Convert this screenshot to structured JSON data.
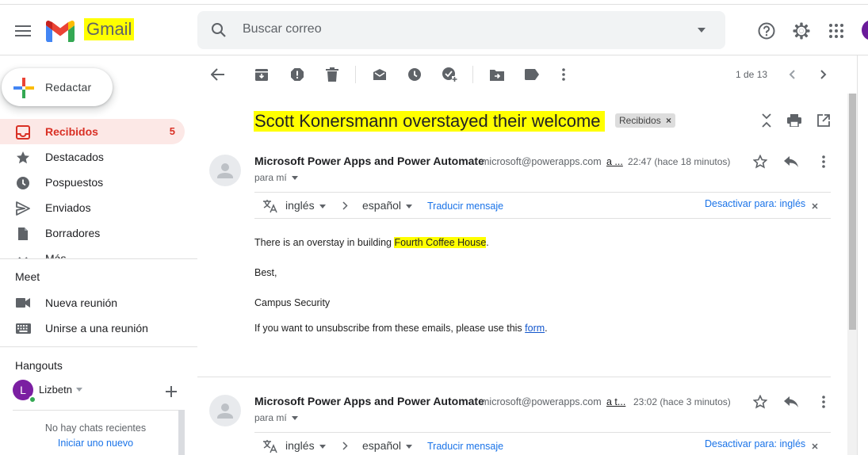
{
  "app": {
    "logo_text": "Gmail"
  },
  "search": {
    "placeholder": "Buscar correo"
  },
  "compose": {
    "label": "Redactar"
  },
  "sidebar": {
    "items": [
      {
        "label": "Recibidos",
        "count": "5",
        "icon": "inbox-icon"
      },
      {
        "label": "Destacados",
        "icon": "star-icon"
      },
      {
        "label": "Pospuestos",
        "icon": "clock-icon"
      },
      {
        "label": "Enviados",
        "icon": "send-icon"
      },
      {
        "label": "Borradores",
        "icon": "draft-icon"
      },
      {
        "label": "Más",
        "icon": "chevron-down-icon"
      }
    ]
  },
  "meet": {
    "title": "Meet",
    "new_meeting": "Nueva reunión",
    "join_meeting": "Unirse a una reunión"
  },
  "hangouts": {
    "title": "Hangouts",
    "user_initial": "L",
    "user_name": "Lizbetn",
    "no_chats": "No hay chats recientes",
    "start_new": "Iniciar uno nuevo"
  },
  "toolbar": {
    "pager": "1 de 13"
  },
  "thread": {
    "subject": "Scott Konersmann overstayed their welcome",
    "label": "Recibidos",
    "label_remove": "×"
  },
  "messages": [
    {
      "sender": "Microsoft Power Apps and Power Automate",
      "email": "microsoft@powerapps.com",
      "email_trunc": "a ...",
      "time": "22:47 (hace 18 minutos)",
      "to": "para mí",
      "from_lang": "inglés",
      "to_lang": "español",
      "translate": "Traducir mensaje",
      "disable": "Desactivar para: inglés",
      "body": {
        "line1_pre": "There is an overstay in building ",
        "line1_hl": "Fourth Coffee House",
        "line1_post": ".",
        "line2": "Best,",
        "line3": "Campus Security",
        "line4_pre": "If you want to unsubscribe from these emails, please use this ",
        "line4_link": "form",
        "line4_post": "."
      }
    },
    {
      "sender": "Microsoft Power Apps and Power Automate",
      "email": "microsoft@powerapps.com",
      "email_trunc": "a t...",
      "time": "23:02 (hace 3 minutos)",
      "to": "para mí",
      "from_lang": "inglés",
      "to_lang": "español",
      "translate": "Traducir mensaje",
      "disable": "Desactivar para: inglés"
    }
  ],
  "colors": {
    "accent_red": "#d93025",
    "highlight": "#ffff00",
    "link": "#1a73e8"
  }
}
